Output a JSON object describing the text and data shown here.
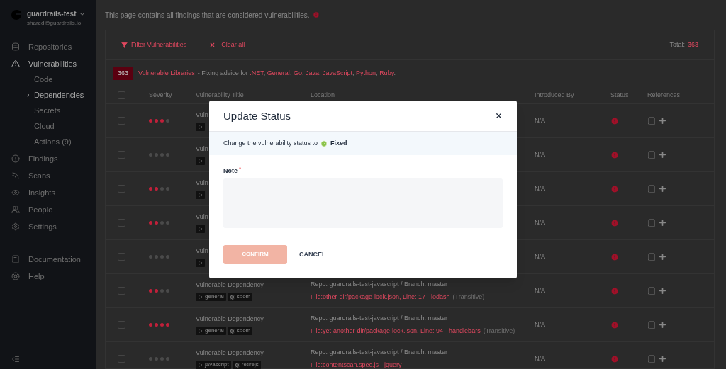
{
  "sidebar": {
    "workspace": "guardrails-test",
    "email": "shared@guardrails.io",
    "nav": [
      {
        "label": "Repositories",
        "active": false
      },
      {
        "label": "Vulnerabilities",
        "active": true,
        "expanded": true,
        "children": [
          {
            "label": "Code",
            "selected": false
          },
          {
            "label": "Dependencies",
            "selected": true
          },
          {
            "label": "Secrets",
            "selected": false
          },
          {
            "label": "Cloud",
            "selected": false
          },
          {
            "label": "Actions (9)",
            "selected": false
          }
        ]
      },
      {
        "label": "Findings",
        "active": false
      },
      {
        "label": "Scans",
        "active": false
      },
      {
        "label": "Insights",
        "active": false
      },
      {
        "label": "People",
        "active": false
      },
      {
        "label": "Settings",
        "active": false
      }
    ],
    "footer_links": [
      {
        "label": "Documentation"
      },
      {
        "label": "Help"
      }
    ]
  },
  "intro": "This page contains all findings that are considered vulnerabilities.",
  "toolbar": {
    "filter": "Filter Vulnerabilities",
    "clear": "Clear all",
    "total_label": "Total:",
    "total": "363"
  },
  "advice": {
    "count": "363",
    "title": "Vulnerable Libraries",
    "text": "- Fixing advice for",
    "links": [
      {
        "label": ".NET",
        "after": ","
      },
      {
        "label": "General",
        "after": ","
      },
      {
        "label": "Go",
        "after": ","
      },
      {
        "label": "Java",
        "after": ","
      },
      {
        "label": "JavaScript",
        "after": ","
      },
      {
        "label": "Python",
        "after": ","
      },
      {
        "label": "Ruby",
        "after": "."
      }
    ]
  },
  "table": {
    "select_all_checked": false,
    "columns": [
      "Severity",
      "Vulnerability Title",
      "Location",
      "Introduced By",
      "Status",
      "References"
    ],
    "rows": [
      {
        "checked": false,
        "stars": 3,
        "title": "Vuln",
        "tags": [
          {
            "kind": "language"
          }
        ],
        "introduced_by": "N/A"
      },
      {
        "checked": false,
        "stars": 0,
        "title": "Vuln",
        "tags": [
          {
            "kind": "language"
          }
        ],
        "introduced_by": "N/A"
      },
      {
        "checked": false,
        "stars": 2,
        "title": "Vuln",
        "tags": [
          {
            "kind": "language"
          }
        ],
        "introduced_by": "N/A"
      },
      {
        "checked": false,
        "stars": 2,
        "title": "Vuln",
        "tags": [
          {
            "kind": "language"
          }
        ],
        "introduced_by": "N/A"
      },
      {
        "checked": false,
        "stars": 0,
        "title": "Vuln",
        "tags": [
          {
            "kind": "language"
          }
        ],
        "introduced_by": "N/A"
      },
      {
        "checked": false,
        "stars": 2,
        "title": "Vulnerable Dependency",
        "tags": [
          {
            "kind": "language",
            "label": "general"
          },
          {
            "kind": "engine",
            "label": "sbom"
          }
        ],
        "repo": "Repo: guardrails-test-javascript / Branch: master",
        "file": "File:other-dir/package-lock.json, Line: 17 - lodash",
        "file_note": "(Transitive)",
        "introduced_by": "N/A"
      },
      {
        "checked": false,
        "stars": 4,
        "title": "Vulnerable Dependency",
        "tags": [
          {
            "kind": "language",
            "label": "general"
          },
          {
            "kind": "engine",
            "label": "sbom"
          }
        ],
        "repo": "Repo: guardrails-test-javascript / Branch: master",
        "file": "File:yet-another-dir/package-lock.json, Line: 94 - handlebars",
        "file_note": "(Transitive)",
        "introduced_by": "N/A"
      },
      {
        "checked": false,
        "stars": 0,
        "title": "Vulnerable Dependency",
        "tags": [
          {
            "kind": "language",
            "label": "javascript"
          },
          {
            "kind": "engine",
            "label": "retirejs"
          }
        ],
        "repo": "Repo: guardrails-test-javascript / Branch: master",
        "file": "File:contentscan.spec.js - jquery",
        "introduced_by": "N/A"
      }
    ]
  },
  "modal": {
    "title": "Update Status",
    "text": "Change the vulnerability status to",
    "status": "Fixed",
    "note_label": "Note",
    "required_mark": "*",
    "confirm": "CONFIRM",
    "confirm_disabled": true,
    "cancel": "CANCEL"
  }
}
